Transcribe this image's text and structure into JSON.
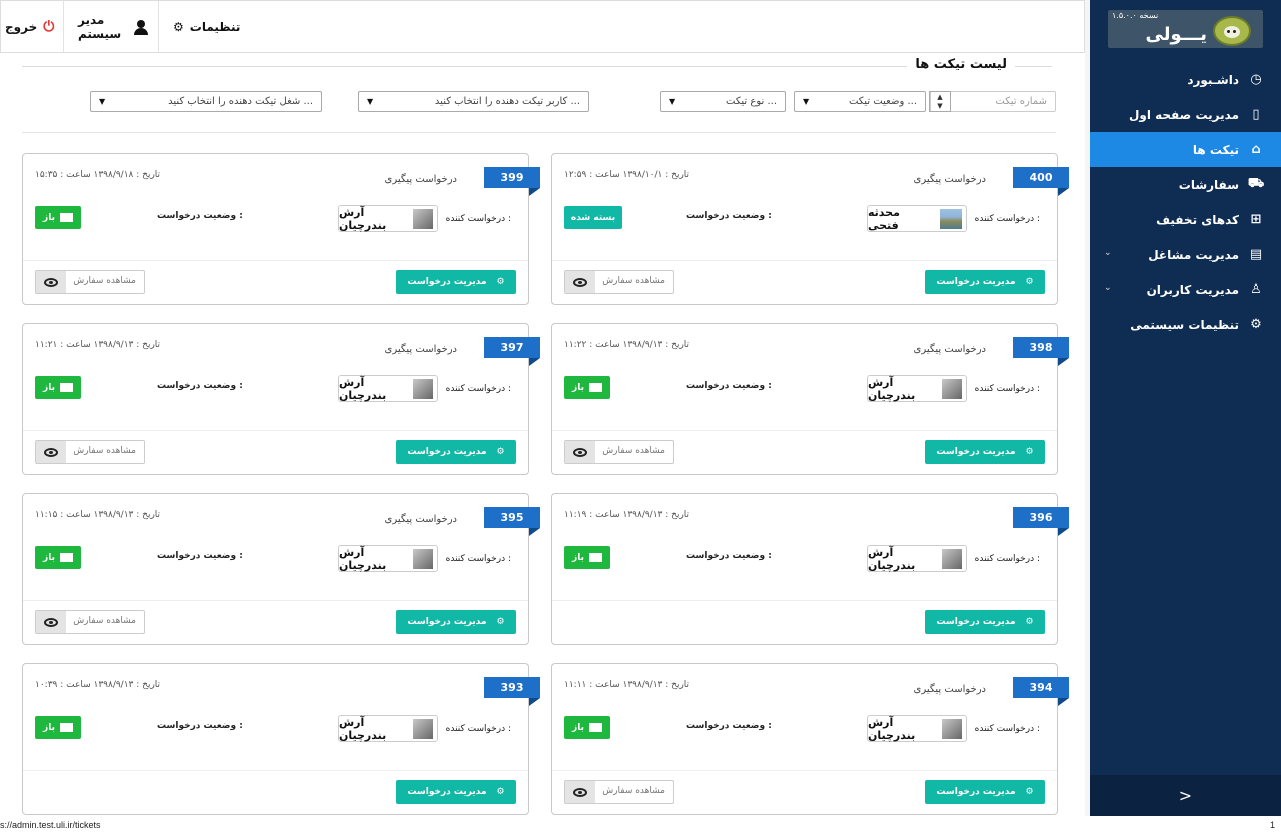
{
  "sidebar": {
    "version": "نسخه ۱.۵.۰.۰",
    "brand": "یـــولی",
    "items": [
      {
        "label": "داشـبورد",
        "icon": "dashboard-icon",
        "glyph": "◷"
      },
      {
        "label": "مدیریت صفحه اول",
        "icon": "phone-icon",
        "glyph": "▯"
      },
      {
        "label": "تیکت ها",
        "icon": "tag-icon",
        "glyph": "⌂",
        "active": true
      },
      {
        "label": "سفارشات",
        "icon": "cart-icon",
        "glyph": "⛟"
      },
      {
        "label": "کدهای تخفیف",
        "icon": "gift-icon",
        "glyph": "⊞"
      },
      {
        "label": "مدیریت مشاغل",
        "icon": "store-icon",
        "glyph": "▤",
        "has_children": true
      },
      {
        "label": "مدیریت کاربران",
        "icon": "users-icon",
        "glyph": "♙",
        "has_children": true
      },
      {
        "label": "تنظیمات سیستمی",
        "icon": "gear-icon",
        "glyph": "⚙"
      }
    ],
    "collapse_glyph": ">"
  },
  "topbar": {
    "settings_label": "تنظیمات",
    "admin_label": "مدیر سیستم",
    "logout_label": "خروج"
  },
  "main": {
    "title": "لیست تیکت ها",
    "filters": {
      "ticket_number_placeholder": "شماره تیکت",
      "status": "وضعیت تیکت ...",
      "type": "نوع تیکت ...",
      "user": "کاربر تیکت دهنده را انتخاب کنید ...",
      "business": "شغل تیکت دهنده را انتخاب کنید ..."
    },
    "labels": {
      "requester": "درخواست کننده :",
      "status": "وضعیت درخواست :",
      "manage": "مدیریت درخواست",
      "view_order": "مشاهده سفارش",
      "open": "باز",
      "closed": "بسته شده",
      "type": "درخواست پیگیری"
    },
    "tickets": [
      {
        "id": "400",
        "type": "درخواست پیگیری",
        "date": "تاریخ : ۱۳۹۸/۱۰/۱  ساعت : ۱۲:۵۹",
        "user": "محدثه فتحی",
        "status": "بسته شده",
        "closed": true,
        "view": true
      },
      {
        "id": "399",
        "type": "درخواست پیگیری",
        "date": "تاریخ : ۱۳۹۸/۹/۱۸  ساعت : ۱۵:۳۵",
        "user": "آرش بندرچیان",
        "status": "باز",
        "closed": false,
        "view": true
      },
      {
        "id": "398",
        "type": "درخواست پیگیری",
        "date": "تاریخ : ۱۳۹۸/۹/۱۳  ساعت : ۱۱:۲۲",
        "user": "آرش بندرچیان",
        "status": "باز",
        "closed": false,
        "view": true
      },
      {
        "id": "397",
        "type": "درخواست پیگیری",
        "date": "تاریخ : ۱۳۹۸/۹/۱۳  ساعت : ۱۱:۲۱",
        "user": "آرش بندرچیان",
        "status": "باز",
        "closed": false,
        "view": true
      },
      {
        "id": "396",
        "type": "",
        "date": "تاریخ : ۱۳۹۸/۹/۱۳  ساعت : ۱۱:۱۹",
        "user": "آرش بندرچیان",
        "status": "باز",
        "closed": false,
        "view": false
      },
      {
        "id": "395",
        "type": "درخواست پیگیری",
        "date": "تاریخ : ۱۳۹۸/۹/۱۳  ساعت : ۱۱:۱۵",
        "user": "آرش بندرچیان",
        "status": "باز",
        "closed": false,
        "view": true
      },
      {
        "id": "394",
        "type": "درخواست پیگیری",
        "date": "تاریخ : ۱۳۹۸/۹/۱۳  ساعت : ۱۱:۱۱",
        "user": "آرش بندرچیان",
        "status": "باز",
        "closed": false,
        "view": true
      },
      {
        "id": "393",
        "type": "",
        "date": "تاریخ : ۱۳۹۸/۹/۱۳  ساعت : ۱۰:۳۹",
        "user": "آرش بندرچیان",
        "status": "باز",
        "closed": false,
        "view": false
      }
    ]
  },
  "statusbar": {
    "url": "s://admin.test.uli.ir/tickets",
    "count": "1"
  }
}
